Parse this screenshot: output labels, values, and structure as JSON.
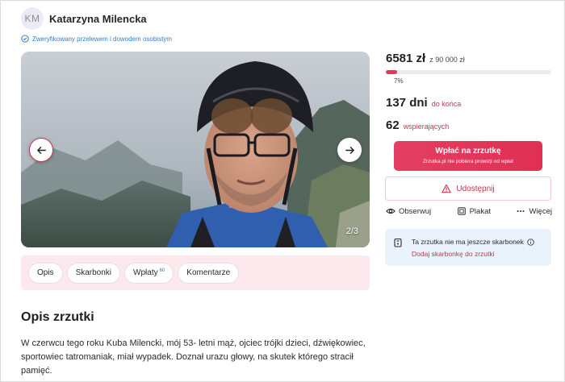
{
  "author": {
    "initials": "KM",
    "name": "Katarzyna Milencka",
    "verified_text": "Zweryfikowany przelewem i dowodem osobistym"
  },
  "gallery": {
    "counter": "2/3",
    "prev_icon": "arrow-left-icon",
    "next_icon": "arrow-right-icon"
  },
  "tabs": [
    {
      "label": "Opis"
    },
    {
      "label": "Skarbonki"
    },
    {
      "label": "Wpłaty",
      "badge": "60"
    },
    {
      "label": "Komentarze"
    }
  ],
  "description": {
    "title": "Opis zrzutki",
    "text": "W czerwcu tego roku Kuba Milencki, mój 53- letni mąż, ojciec trójki dzieci, dźwiękowiec, sportowiec tatromaniak, miał wypadek. Doznał urazu głowy, na skutek którego stracił pamięć."
  },
  "funding": {
    "amount": "6581 zł",
    "goal": "z 90 000 zł",
    "percent_label": "7%",
    "progress_fraction": 0.07,
    "days": "137 dni",
    "days_label": "do końca",
    "supporters": "62",
    "supporters_label": "wspierających"
  },
  "buttons": {
    "pay_main": "Wpłać na zrzutkę",
    "pay_sub": "Zrzutka.pl nie pobiera prowizji od wpłat",
    "share": "Udostępnij",
    "observe": "Obserwuj",
    "poster": "Plakat",
    "more": "Więcej"
  },
  "piggybank": {
    "title": "Ta zrzutka nie ma jeszcze skarbonek",
    "link": "Dodaj skarbonkę do zrzutki"
  },
  "colors": {
    "accent": "#e23a5c",
    "accent_text": "#c2364f",
    "link_blue": "#3a7cc4",
    "tabs_bg": "#fbe9ee",
    "info_bg": "#eaf2fb"
  }
}
